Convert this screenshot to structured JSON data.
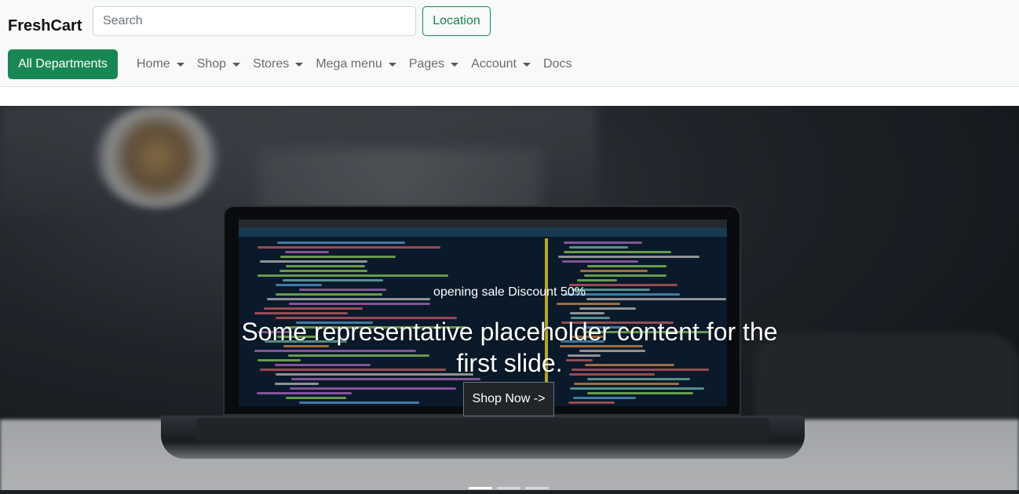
{
  "navbar": {
    "brand": "FreshCart",
    "search_placeholder": "Search",
    "location_label": "Location",
    "departments_label": "All Departments",
    "items": [
      {
        "label": "Home",
        "has_caret": true
      },
      {
        "label": "Shop",
        "has_caret": true
      },
      {
        "label": "Stores",
        "has_caret": true
      },
      {
        "label": "Mega menu",
        "has_caret": true
      },
      {
        "label": "Pages",
        "has_caret": true
      },
      {
        "label": "Account",
        "has_caret": true
      },
      {
        "label": "Docs",
        "has_caret": false
      }
    ]
  },
  "hero": {
    "subtitle": "opening sale Discount 50%",
    "title": "Some representative placeholder content for the first slide.",
    "button_label": "Shop Now ->",
    "slides": 3,
    "active_slide": 1
  },
  "colors": {
    "primary_green": "#198754",
    "dark_button": "#212529",
    "navbar_bg": "#f8f9fa"
  }
}
